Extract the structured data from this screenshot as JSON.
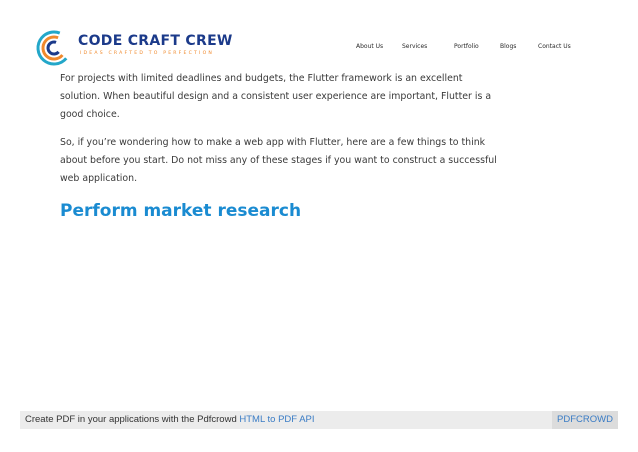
{
  "brand": {
    "name": "CODE CRAFT CREW",
    "tagline": "IDEAS CRAFTED TO PERFECTION",
    "colors": {
      "navy": "#1b3a8a",
      "orange": "#f0892c",
      "teal": "#23a7c9"
    }
  },
  "nav": {
    "items": [
      "About Us",
      "Services",
      "Portfolio",
      "Blogs",
      "Contact Us"
    ]
  },
  "article": {
    "paragraph_1": [
      "For projects with limited deadlines and budgets, the Flutter framework is an excellent",
      "solution. When beautiful design and a consistent user experience are important, Flutter is a",
      "good choice."
    ],
    "paragraph_2": [
      "So, if you’re wondering how to make a web app with Flutter, here are a few things to think",
      "about before you start. Do not miss any of these stages if you want to construct a successful",
      "web application."
    ],
    "section_heading": "Perform market research",
    "heading_color": "#1a8bd1"
  },
  "footer": {
    "text": "Create PDF in your applications with the Pdfcrowd",
    "link_label": "HTML to PDF API",
    "brand_label": "PDFCROWD"
  }
}
